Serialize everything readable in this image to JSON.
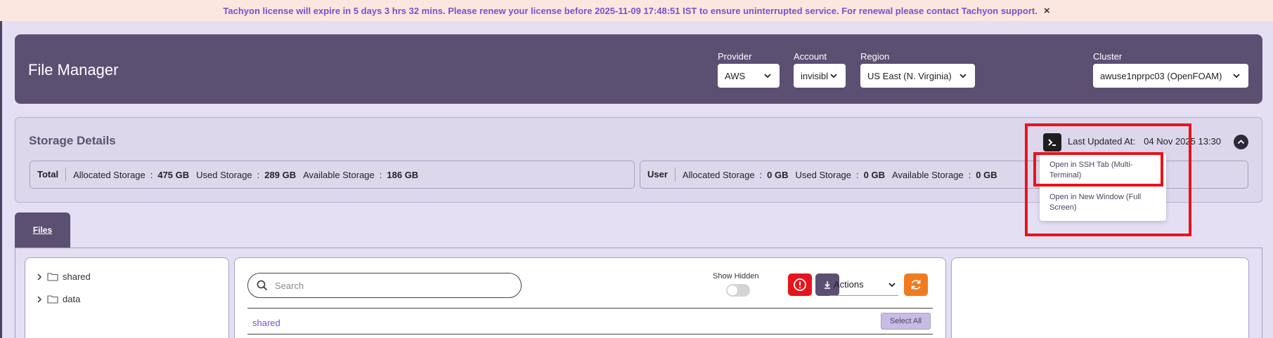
{
  "banner": {
    "message": "Tachyon license will expire in 5 days 3 hrs 32 mins. Please renew your license before 2025-11-09 17:48:51 IST to ensure uninterrupted service. For renewal please contact Tachyon support.",
    "close_glyph": "×"
  },
  "header": {
    "title": "File Manager",
    "provider": {
      "label": "Provider",
      "value": "AWS"
    },
    "account": {
      "label": "Account",
      "value": "invisibl"
    },
    "region": {
      "label": "Region",
      "value": "US East (N. Virginia)"
    },
    "cluster": {
      "label": "Cluster",
      "value": "awuse1nprpc03 (OpenFOAM)"
    }
  },
  "storage": {
    "title": "Storage Details",
    "last_updated_label": "Last Updated At:",
    "last_updated_value": "04 Nov 2025 13:30",
    "total": {
      "label": "Total",
      "allocated_label": "Allocated Storage",
      "allocated_value": "475 GB",
      "used_label": "Used Storage",
      "used_value": "289 GB",
      "available_label": "Available Storage",
      "available_value": "186 GB"
    },
    "user": {
      "label": "User",
      "allocated_label": "Allocated Storage",
      "allocated_value": "0 GB",
      "used_label": "Used Storage",
      "used_value": "0 GB",
      "available_label": "Available Storage",
      "available_value": "0 GB"
    },
    "separator": ":"
  },
  "terminal_menu": {
    "items": [
      "Open in SSH Tab (Multi-Terminal)",
      "Open in New Window (Full Screen)"
    ]
  },
  "tabs": [
    {
      "label": "Files",
      "active": true
    }
  ],
  "tree": {
    "items": [
      {
        "label": "shared"
      },
      {
        "label": "data"
      }
    ]
  },
  "browser": {
    "search_placeholder": "Search",
    "show_hidden_label": "Show Hidden",
    "show_hidden_on": false,
    "actions_label": "Actions",
    "path": "shared",
    "select_all_label": "Select All"
  },
  "colors": {
    "banner_bg": "#fbe7df",
    "banner_text": "#7a4fd0",
    "header_bg": "#5b5072",
    "page_bg": "#e4dff3",
    "alert_red": "#e8141c",
    "refresh_orange": "#f07b1e",
    "download_purple": "#5b5072"
  }
}
